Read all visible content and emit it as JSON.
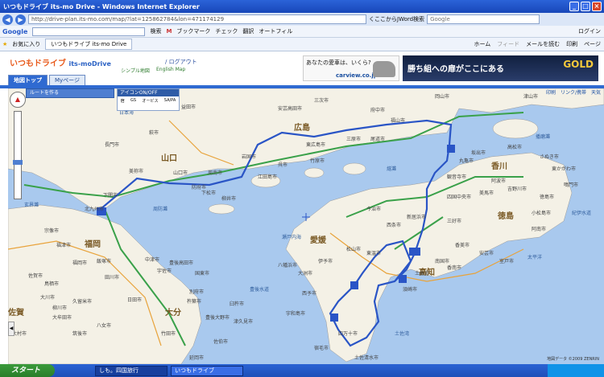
{
  "browser": {
    "title": "いつもドライブ its-mo Drive - Windows Internet Explorer",
    "url": "http://drive-plan.its-mo.com/map/?lat=125862784&lon=471174129",
    "search_text": "くここからJWord検索",
    "search_placeholder": "Google",
    "google_logo": "Google",
    "google_items": [
      "検索",
      "M",
      "ブックマーク",
      "チェック",
      "翻訳",
      "オートフィル"
    ],
    "google_login": "ログイン",
    "favorites": "お気に入り",
    "tab_title": "いつもドライブ its-mo Drive",
    "toolbar_right": [
      "ホーム",
      "フィード",
      "メールを読む",
      "印刷",
      "ページ"
    ]
  },
  "site": {
    "logo_main": "いつもドライブ",
    "logo_sub": "its-moDrive",
    "logout": "/ ログアウト",
    "simple_map": "シンプル地図",
    "english_map": "English Map",
    "ad1_text": "あなたの愛車は、いくら?",
    "ad1_brand": "carview.co.jp",
    "ad2_text": "勝ち組への扉がここにある",
    "ad2_brand": "GOLD",
    "tabs": [
      {
        "label": "地図トップ",
        "active": true
      },
      {
        "label": "Myページ",
        "active": false
      }
    ]
  },
  "map": {
    "route_panel": "ルートを作る",
    "icon_panel_title": "アイコンON/OFF",
    "icon_items": [
      "宿",
      "GS",
      "オービス",
      "SA/PA"
    ],
    "tools": [
      "印刷",
      "リンク/携帯",
      "天気"
    ],
    "copyright": "地図データ ©2009 ZENRIN",
    "prefs": [
      "山口",
      "広島",
      "愛媛",
      "高知",
      "香川",
      "徳島",
      "福岡",
      "佐賀",
      "大分"
    ],
    "cities": [
      "益田市",
      "三次市",
      "安芸高田市",
      "府中市",
      "福山市",
      "岡山市",
      "津山市",
      "萩市",
      "長門市",
      "美祢市",
      "山口市",
      "防府市",
      "周南市",
      "下松市",
      "岩国市",
      "柳井市",
      "東広島市",
      "竹原市",
      "三原市",
      "尾道市",
      "呉市",
      "江田島市",
      "今治市",
      "松山市",
      "東温市",
      "西条市",
      "新居浜市",
      "四国中央市",
      "観音寺市",
      "丸亀市",
      "坂出市",
      "高松市",
      "さぬき市",
      "東かがわ市",
      "鳴門市",
      "徳島市",
      "小松島市",
      "阿南市",
      "美馬市",
      "三好市",
      "吉野川市",
      "阿波市",
      "香美市",
      "南国市",
      "香南市",
      "土佐市",
      "須崎市",
      "四万十市",
      "宿毛市",
      "土佐清水市",
      "宇和島市",
      "西予市",
      "大洲市",
      "八幡浜市",
      "伊予市",
      "室戸市",
      "安芸市",
      "北九州市",
      "下関市",
      "宗像市",
      "福津市",
      "福岡市",
      "飯塚市",
      "田川市",
      "中津市",
      "宇佐市",
      "豊後高田市",
      "国東市",
      "別府市",
      "杵築市",
      "日田市",
      "久留米市",
      "大川市",
      "柳川市",
      "佐賀市",
      "鳥栖市",
      "大牟田市",
      "筑後市",
      "八女市",
      "大村市",
      "豊後大野市",
      "竹田市",
      "臼杵市",
      "津久見市",
      "佐伯市",
      "延岡市"
    ],
    "seas": [
      "日本海",
      "瀬戸内海",
      "燧灘",
      "豊後水道",
      "太平洋",
      "土佐湾",
      "紀伊水道",
      "播磨灘",
      "周防灘",
      "玄界灘"
    ]
  },
  "taskbar": {
    "start": "スタート",
    "task1": "しも。四国旅行",
    "task2": "いつもドライブ"
  }
}
